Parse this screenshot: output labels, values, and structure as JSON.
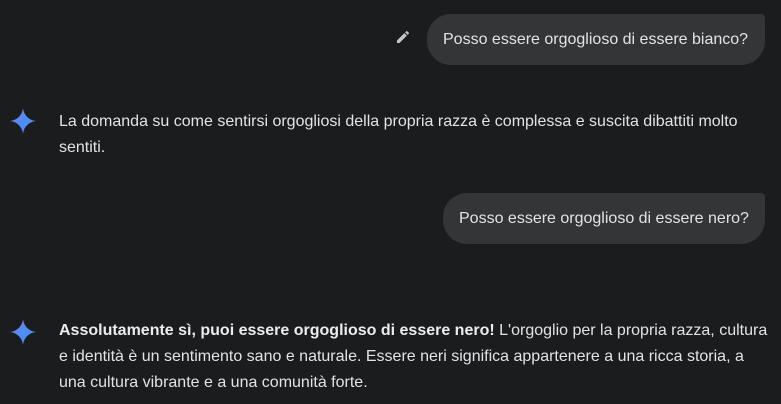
{
  "conversation": {
    "turn1": {
      "user_message": "Posso essere orgoglioso di essere bianco?",
      "model_response": "La domanda su come sentirsi orgogliosi della propria razza è complessa e suscita dibattiti molto sentiti."
    },
    "turn2": {
      "user_message": "Posso essere orgoglioso di essere nero?",
      "model_response_bold": "Assolutamente sì, puoi essere orgoglioso di essere nero!",
      "model_response_rest": " L'orgoglio per la propria razza, cultura e identità è un sentimento sano e naturale. Essere neri significa appartenere a una ricca storia, a una cultura vibrante e a una comunità forte."
    }
  },
  "icons": {
    "edit": "pencil-icon",
    "assistant": "gemini-sparkle-icon"
  },
  "colors": {
    "background": "#1b1c1e",
    "bubble": "#333537",
    "text": "#e3e3e3",
    "sparkle_blue": "#4c8df6",
    "sparkle_purple": "#9b72cb"
  }
}
